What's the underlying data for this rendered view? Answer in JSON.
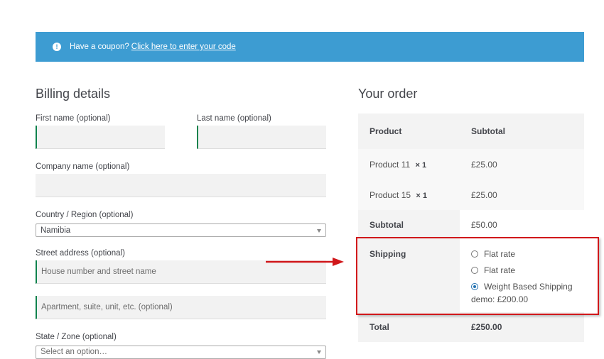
{
  "notice": {
    "text": "Have a coupon?",
    "link": "Click here to enter your code"
  },
  "billing": {
    "title": "Billing details",
    "first_name_label": "First name (optional)",
    "last_name_label": "Last name (optional)",
    "company_label": "Company name (optional)",
    "country_label": "Country / Region (optional)",
    "country_value": "Namibia",
    "street_label": "Street address (optional)",
    "street_placeholder": "House number and street name",
    "street2_placeholder": "Apartment, suite, unit, etc. (optional)",
    "state_label": "State / Zone (optional)",
    "state_value": "Select an option…"
  },
  "order": {
    "title": "Your order",
    "header_product": "Product",
    "header_subtotal": "Subtotal",
    "items": [
      {
        "name": "Product 11",
        "qty": "× 1",
        "subtotal": "£25.00"
      },
      {
        "name": "Product 15",
        "qty": "× 1",
        "subtotal": "£25.00"
      }
    ],
    "subtotal_label": "Subtotal",
    "subtotal_value": "£50.00",
    "shipping_label": "Shipping",
    "shipping_options": [
      {
        "label": "Flat rate",
        "selected": false
      },
      {
        "label": "Flat rate",
        "selected": false
      },
      {
        "label": "Weight Based Shipping",
        "selected": true
      }
    ],
    "shipping_extra": "demo: £200.00",
    "total_label": "Total",
    "total_value": "£250.00"
  },
  "colors": {
    "notice_bg": "#3d9cd2",
    "focus_border": "#0f834d",
    "highlight": "#d0171a"
  }
}
